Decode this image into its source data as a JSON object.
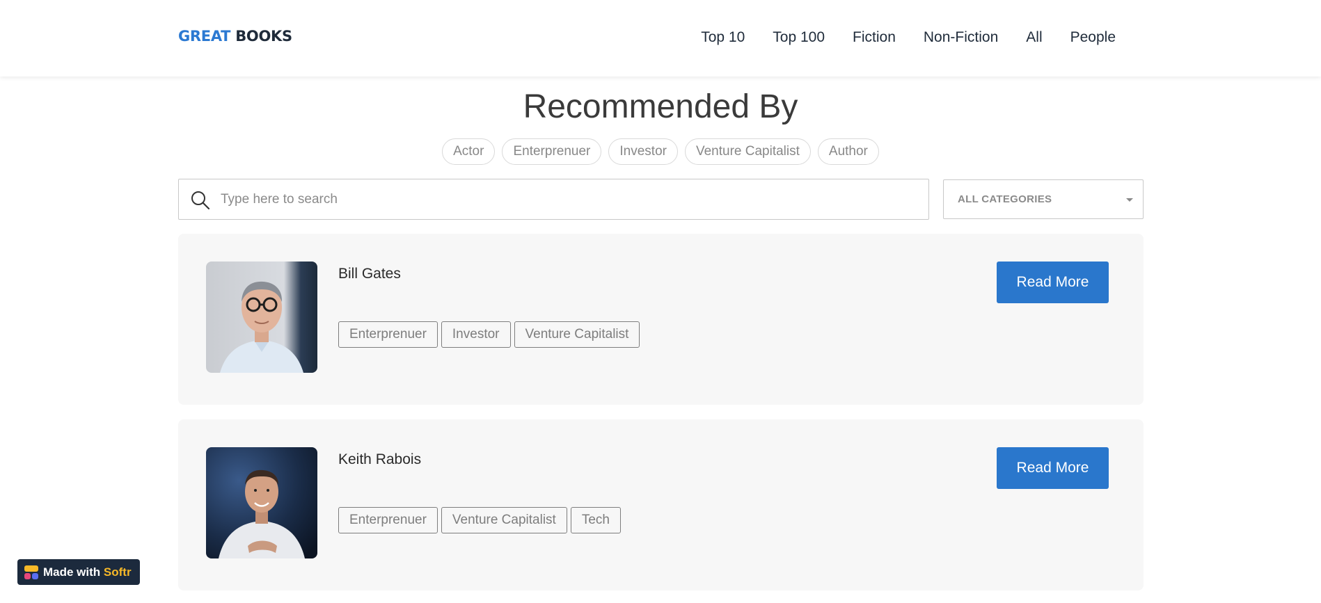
{
  "header": {
    "logo": {
      "part1": "GREAT",
      "part2": "BOOKS"
    },
    "nav": [
      "Top 10",
      "Top 100",
      "Fiction",
      "Non-Fiction",
      "All",
      "People"
    ]
  },
  "main": {
    "title": "Recommended By",
    "filters": [
      "Actor",
      "Enterprenuer",
      "Investor",
      "Venture Capitalist",
      "Author"
    ],
    "search": {
      "placeholder": "Type here to search",
      "value": ""
    },
    "category_select": {
      "selected": "ALL CATEGORIES"
    },
    "people": [
      {
        "name": "Bill Gates",
        "tags": [
          "Enterprenuer",
          "Investor",
          "Venture Capitalist"
        ],
        "button": "Read More"
      },
      {
        "name": "Keith Rabois",
        "tags": [
          "Enterprenuer",
          "Venture Capitalist",
          "Tech"
        ],
        "button": "Read More"
      }
    ]
  },
  "badge": {
    "prefix": "Made with",
    "brand": "Softr"
  },
  "colors": {
    "accent": "#2a77cc",
    "logo_blue": "#2b79d2",
    "logo_dark": "#1f2b3a",
    "card_bg": "#f7f7f7",
    "badge_bg": "#1c2a3d",
    "badge_brand": "#f7b928"
  },
  "icons": {
    "search": "search-icon",
    "select_caret": "chevron-down-icon",
    "badge_logo": "softr-logo-icon"
  }
}
